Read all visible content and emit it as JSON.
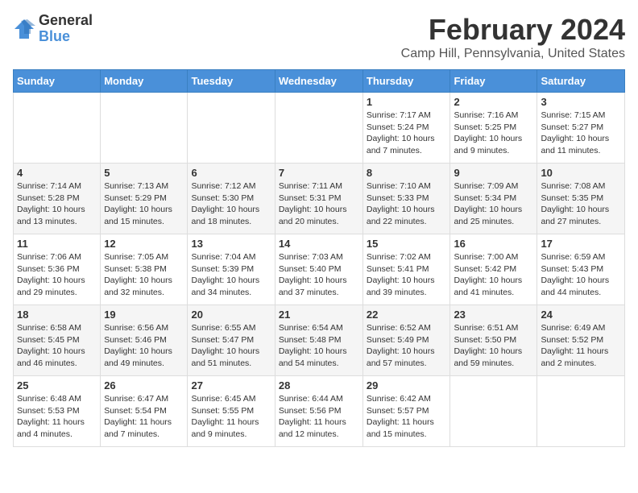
{
  "logo": {
    "general": "General",
    "blue": "Blue"
  },
  "title": "February 2024",
  "subtitle": "Camp Hill, Pennsylvania, United States",
  "weekdays": [
    "Sunday",
    "Monday",
    "Tuesday",
    "Wednesday",
    "Thursday",
    "Friday",
    "Saturday"
  ],
  "weeks": [
    [
      {
        "day": "",
        "info": ""
      },
      {
        "day": "",
        "info": ""
      },
      {
        "day": "",
        "info": ""
      },
      {
        "day": "",
        "info": ""
      },
      {
        "day": "1",
        "info": "Sunrise: 7:17 AM\nSunset: 5:24 PM\nDaylight: 10 hours\nand 7 minutes."
      },
      {
        "day": "2",
        "info": "Sunrise: 7:16 AM\nSunset: 5:25 PM\nDaylight: 10 hours\nand 9 minutes."
      },
      {
        "day": "3",
        "info": "Sunrise: 7:15 AM\nSunset: 5:27 PM\nDaylight: 10 hours\nand 11 minutes."
      }
    ],
    [
      {
        "day": "4",
        "info": "Sunrise: 7:14 AM\nSunset: 5:28 PM\nDaylight: 10 hours\nand 13 minutes."
      },
      {
        "day": "5",
        "info": "Sunrise: 7:13 AM\nSunset: 5:29 PM\nDaylight: 10 hours\nand 15 minutes."
      },
      {
        "day": "6",
        "info": "Sunrise: 7:12 AM\nSunset: 5:30 PM\nDaylight: 10 hours\nand 18 minutes."
      },
      {
        "day": "7",
        "info": "Sunrise: 7:11 AM\nSunset: 5:31 PM\nDaylight: 10 hours\nand 20 minutes."
      },
      {
        "day": "8",
        "info": "Sunrise: 7:10 AM\nSunset: 5:33 PM\nDaylight: 10 hours\nand 22 minutes."
      },
      {
        "day": "9",
        "info": "Sunrise: 7:09 AM\nSunset: 5:34 PM\nDaylight: 10 hours\nand 25 minutes."
      },
      {
        "day": "10",
        "info": "Sunrise: 7:08 AM\nSunset: 5:35 PM\nDaylight: 10 hours\nand 27 minutes."
      }
    ],
    [
      {
        "day": "11",
        "info": "Sunrise: 7:06 AM\nSunset: 5:36 PM\nDaylight: 10 hours\nand 29 minutes."
      },
      {
        "day": "12",
        "info": "Sunrise: 7:05 AM\nSunset: 5:38 PM\nDaylight: 10 hours\nand 32 minutes."
      },
      {
        "day": "13",
        "info": "Sunrise: 7:04 AM\nSunset: 5:39 PM\nDaylight: 10 hours\nand 34 minutes."
      },
      {
        "day": "14",
        "info": "Sunrise: 7:03 AM\nSunset: 5:40 PM\nDaylight: 10 hours\nand 37 minutes."
      },
      {
        "day": "15",
        "info": "Sunrise: 7:02 AM\nSunset: 5:41 PM\nDaylight: 10 hours\nand 39 minutes."
      },
      {
        "day": "16",
        "info": "Sunrise: 7:00 AM\nSunset: 5:42 PM\nDaylight: 10 hours\nand 41 minutes."
      },
      {
        "day": "17",
        "info": "Sunrise: 6:59 AM\nSunset: 5:43 PM\nDaylight: 10 hours\nand 44 minutes."
      }
    ],
    [
      {
        "day": "18",
        "info": "Sunrise: 6:58 AM\nSunset: 5:45 PM\nDaylight: 10 hours\nand 46 minutes."
      },
      {
        "day": "19",
        "info": "Sunrise: 6:56 AM\nSunset: 5:46 PM\nDaylight: 10 hours\nand 49 minutes."
      },
      {
        "day": "20",
        "info": "Sunrise: 6:55 AM\nSunset: 5:47 PM\nDaylight: 10 hours\nand 51 minutes."
      },
      {
        "day": "21",
        "info": "Sunrise: 6:54 AM\nSunset: 5:48 PM\nDaylight: 10 hours\nand 54 minutes."
      },
      {
        "day": "22",
        "info": "Sunrise: 6:52 AM\nSunset: 5:49 PM\nDaylight: 10 hours\nand 57 minutes."
      },
      {
        "day": "23",
        "info": "Sunrise: 6:51 AM\nSunset: 5:50 PM\nDaylight: 10 hours\nand 59 minutes."
      },
      {
        "day": "24",
        "info": "Sunrise: 6:49 AM\nSunset: 5:52 PM\nDaylight: 11 hours\nand 2 minutes."
      }
    ],
    [
      {
        "day": "25",
        "info": "Sunrise: 6:48 AM\nSunset: 5:53 PM\nDaylight: 11 hours\nand 4 minutes."
      },
      {
        "day": "26",
        "info": "Sunrise: 6:47 AM\nSunset: 5:54 PM\nDaylight: 11 hours\nand 7 minutes."
      },
      {
        "day": "27",
        "info": "Sunrise: 6:45 AM\nSunset: 5:55 PM\nDaylight: 11 hours\nand 9 minutes."
      },
      {
        "day": "28",
        "info": "Sunrise: 6:44 AM\nSunset: 5:56 PM\nDaylight: 11 hours\nand 12 minutes."
      },
      {
        "day": "29",
        "info": "Sunrise: 6:42 AM\nSunset: 5:57 PM\nDaylight: 11 hours\nand 15 minutes."
      },
      {
        "day": "",
        "info": ""
      },
      {
        "day": "",
        "info": ""
      }
    ]
  ]
}
